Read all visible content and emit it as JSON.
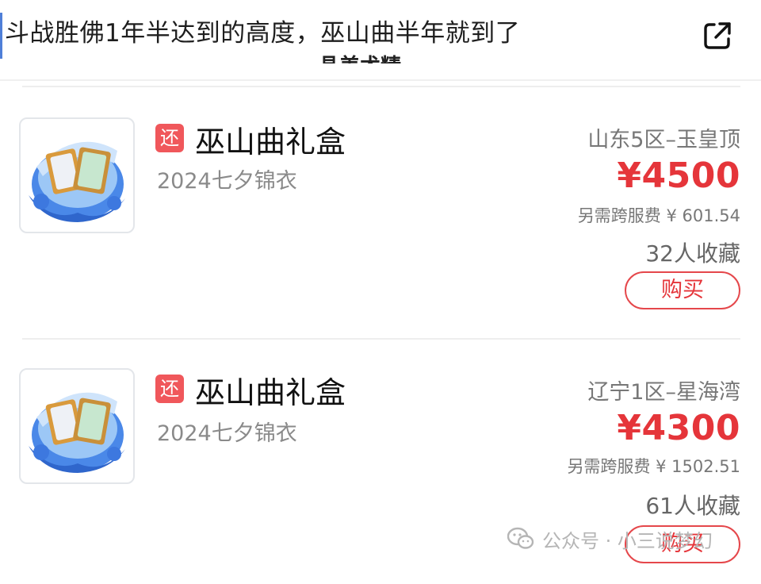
{
  "header": {
    "title": "斗战胜佛1年半达到的高度，巫山曲半年就到了",
    "subtitle": "晶美术精",
    "share_icon": "share-external-icon"
  },
  "listings": [
    {
      "tag": "还",
      "name": "巫山曲礼盒",
      "desc": "2024七夕锦衣",
      "server": "山东5区–玉皇顶",
      "price": "¥4500",
      "fee": "另需跨服费 ¥ 601.54",
      "favs": "32人收藏",
      "buy_label": "购买"
    },
    {
      "tag": "还",
      "name": "巫山曲礼盒",
      "desc": "2024七夕锦衣",
      "server": "辽宁1区–星海湾",
      "price": "¥4300",
      "fee": "另需跨服费 ¥ 1502.51",
      "favs": "61人收藏",
      "buy_label": "购买"
    }
  ],
  "watermark": {
    "text": "公众号 · 小三说梦幻",
    "icon": "wechat-icon"
  },
  "colors": {
    "accent_red": "#e5353a",
    "tag_bg": "#f0575b",
    "muted": "#8a8a8a"
  }
}
